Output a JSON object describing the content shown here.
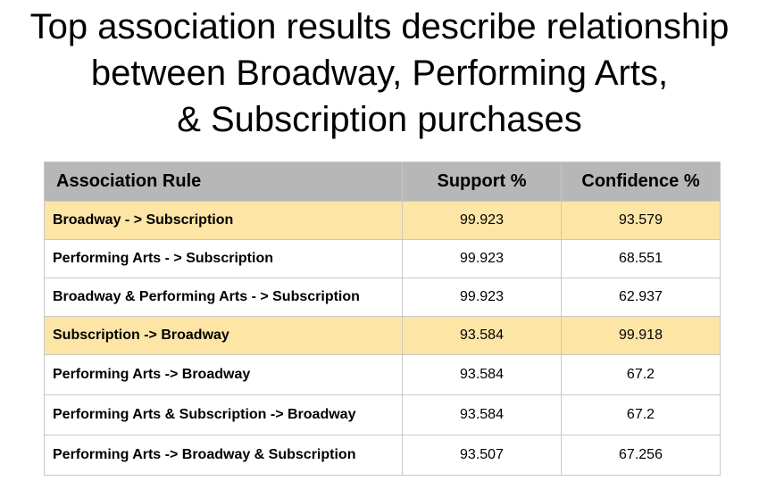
{
  "slide": {
    "title_lines": [
      "Top association results describe relationship",
      "between Broadway, Performing Arts,",
      "& Subscription purchases"
    ],
    "highlight_color": "#fce5a5",
    "header_color": "#b7b7b7"
  },
  "table": {
    "headers": [
      "Association Rule",
      "Support %",
      "Confidence %"
    ],
    "rows": [
      {
        "rule": "Broadway - > Subscription",
        "support": "99.923",
        "confidence": "93.579",
        "highlighted": true
      },
      {
        "rule": "Performing Arts - > Subscription",
        "support": "99.923",
        "confidence": "68.551",
        "highlighted": false
      },
      {
        "rule": "Broadway & Performing Arts - > Subscription",
        "support": "99.923",
        "confidence": "62.937",
        "highlighted": false
      },
      {
        "rule": "Subscription -> Broadway",
        "support": "93.584",
        "confidence": "99.918",
        "highlighted": true
      },
      {
        "rule": "Performing Arts -> Broadway",
        "support": "93.584",
        "confidence": "67.2",
        "highlighted": false
      },
      {
        "rule": "Performing Arts & Subscription -> Broadway",
        "support": "93.584",
        "confidence": "67.2",
        "highlighted": false
      },
      {
        "rule": "Performing Arts -> Broadway & Subscription",
        "support": "93.507",
        "confidence": "67.256",
        "highlighted": false
      }
    ]
  }
}
